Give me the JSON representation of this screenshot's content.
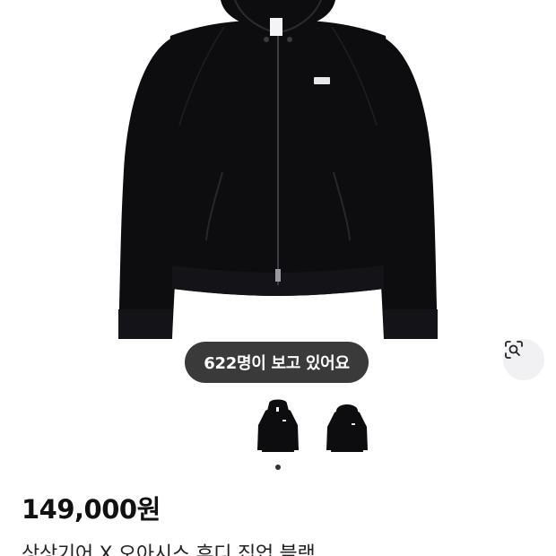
{
  "viewers_badge": "622명이 보고 있어요",
  "product": {
    "price": "149,000원",
    "name": "상상기어 X 오아시스 후디 집업 블랙",
    "image_count": 2,
    "current_image_index": 1
  },
  "icons": {
    "image_search": "lens-search-icon"
  },
  "colors": {
    "garment": "#0d0d10",
    "pill_background": "#3a3a3a",
    "lens_background": "#f1f1f3"
  }
}
